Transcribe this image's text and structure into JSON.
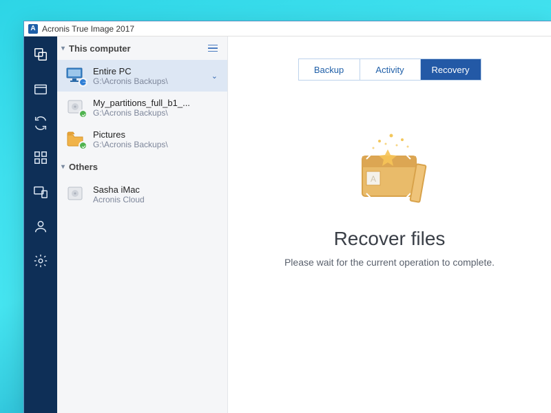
{
  "window": {
    "title": "Acronis True Image 2017"
  },
  "rail": {
    "items": [
      "backup",
      "archive",
      "sync",
      "dashboard",
      "devices",
      "account",
      "settings"
    ]
  },
  "list": {
    "groups": [
      {
        "label": "This computer",
        "items": [
          {
            "title": "Entire PC",
            "sub": "G:\\Acronis Backups\\",
            "icon": "monitor",
            "badge": "blue",
            "selected": true,
            "expandable": true
          },
          {
            "title": "My_partitions_full_b1_...",
            "sub": "G:\\Acronis Backups\\",
            "icon": "drive",
            "badge": "green"
          },
          {
            "title": "Pictures",
            "sub": "G:\\Acronis Backups\\",
            "icon": "folder",
            "badge": "green"
          }
        ]
      },
      {
        "label": "Others",
        "items": [
          {
            "title": "Sasha iMac",
            "sub": "Acronis Cloud",
            "icon": "drive"
          }
        ]
      }
    ]
  },
  "tabs": {
    "items": [
      "Backup",
      "Activity",
      "Recovery"
    ],
    "active": "Recovery"
  },
  "hero": {
    "title": "Recover files",
    "subtitle": "Please wait for the current operation to complete."
  }
}
